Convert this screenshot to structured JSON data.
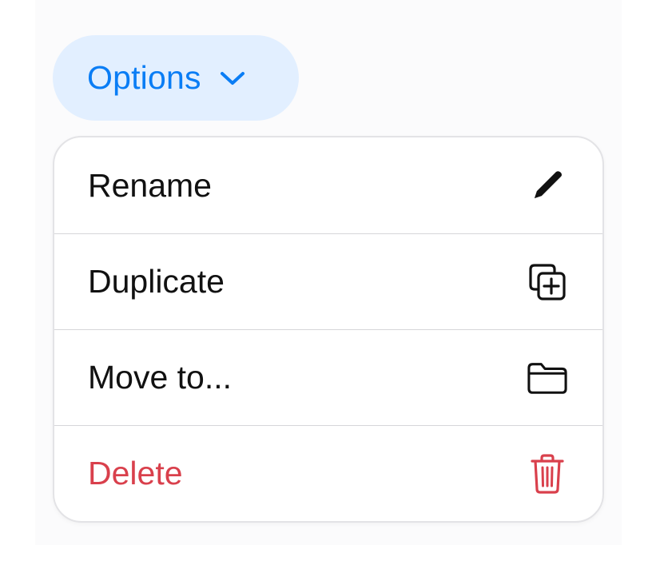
{
  "button": {
    "label": "Options",
    "icon": "chevron-down-icon",
    "color": "#0a7df5",
    "background": "#e2efff"
  },
  "menu": {
    "items": [
      {
        "label": "Rename",
        "icon": "pencil-icon"
      },
      {
        "label": "Duplicate",
        "icon": "duplicate-icon"
      },
      {
        "label": "Move to...",
        "icon": "folder-icon"
      },
      {
        "label": "Delete",
        "icon": "trash-icon",
        "destructive": true,
        "color": "#d9404c"
      }
    ]
  }
}
